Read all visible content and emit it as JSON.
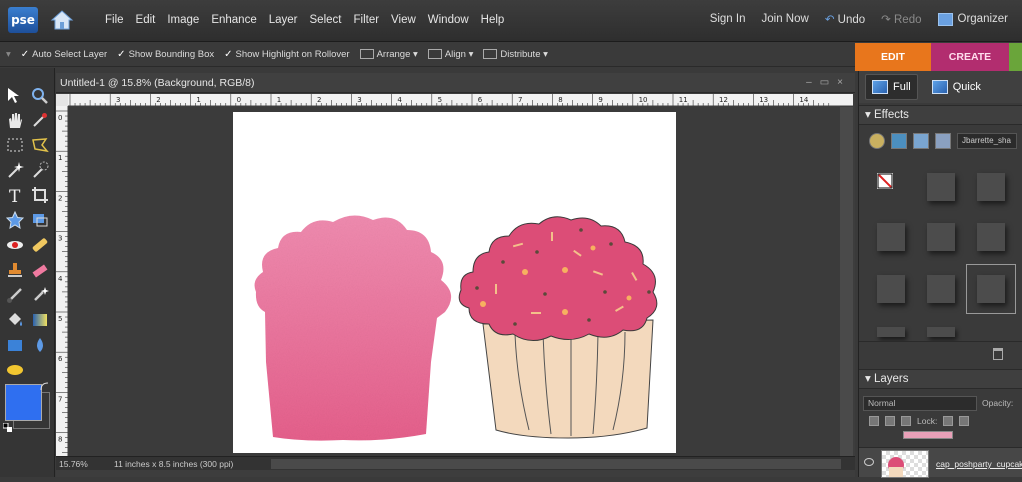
{
  "app": {
    "logo": "pse",
    "menu": [
      "File",
      "Edit",
      "Image",
      "Enhance",
      "Layer",
      "Select",
      "Filter",
      "View",
      "Window",
      "Help"
    ]
  },
  "topright": {
    "signin": "Sign In",
    "join": "Join Now",
    "undo": "Undo",
    "redo": "Redo",
    "organizer": "Organizer"
  },
  "options": {
    "auto_select": "Auto Select Layer",
    "bounding_box": "Show Bounding Box",
    "highlight": "Show Highlight on Rollover",
    "arrange": "Arrange",
    "align": "Align",
    "distribute": "Distribute"
  },
  "modes": {
    "edit": "EDIT",
    "create": "CREATE"
  },
  "document": {
    "title": "Untitled-1 @ 15.8% (Background, RGB/8)",
    "zoom": "15.76%",
    "info": "11 inches x 8.5 inches (300 ppi)"
  },
  "ruler": {
    "top_labels": [
      "3",
      "2",
      "1",
      "0",
      "1",
      "2",
      "3",
      "4",
      "5",
      "6",
      "7",
      "8",
      "9",
      "10",
      "11",
      "12",
      "13",
      "14"
    ],
    "left_labels": [
      "0",
      "1",
      "2",
      "3",
      "4",
      "5",
      "6",
      "7",
      "8"
    ]
  },
  "panel": {
    "view_full": "Full",
    "view_quick": "Quick",
    "effects_title": "Effects",
    "effects_dropdown": "Jbarrette_sha",
    "layers_title": "Layers",
    "blend_mode": "Normal",
    "opacity_label": "Opacity:",
    "lock_label": "Lock:",
    "layer_name": "cap_poshparty_cupcak"
  },
  "colors": {
    "accent_edit": "#e8761c",
    "accent_create": "#b22d6f",
    "foreground": "#2f6ff0",
    "cupcake_pink": "#e87aa0",
    "frosting": "#d94a72",
    "wrapper": "#f3d9bd"
  }
}
